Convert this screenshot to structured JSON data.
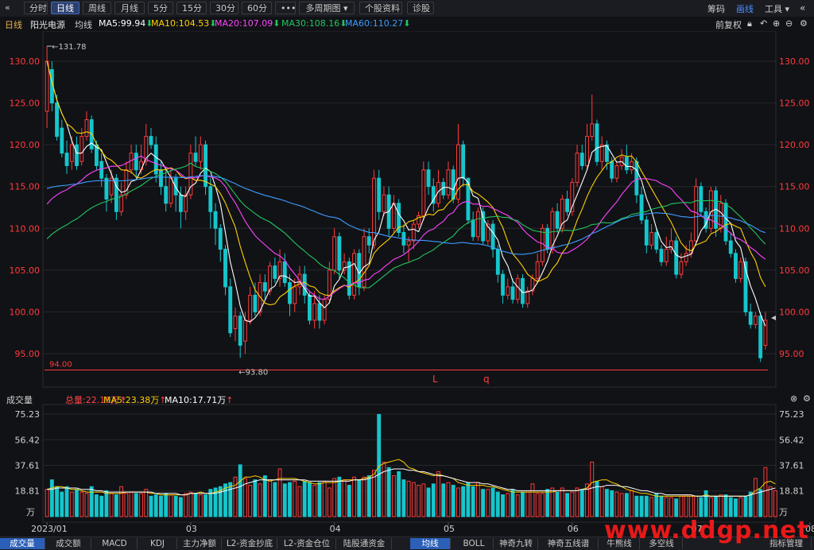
{
  "toolbar": {
    "back": "«",
    "buttons": [
      "分时",
      "日线",
      "周线",
      "月线",
      "5分",
      "15分",
      "30分",
      "60分",
      "•••",
      "多周期图",
      "个股资料",
      "诊股"
    ],
    "active_index": 1,
    "right": [
      "筹码",
      "画线",
      "工具"
    ],
    "right_active_index": 1
  },
  "info": {
    "period": "日线",
    "name": "阳光电源",
    "avg_label": "均线",
    "ma": [
      {
        "label": "MA5:99.94",
        "color": "#ffffff"
      },
      {
        "label": "MA10:104.53",
        "color": "#ffd000"
      },
      {
        "label": "MA20:107.09",
        "color": "#ff44ff"
      },
      {
        "label": "MA30:108.16",
        "color": "#22c55e"
      },
      {
        "label": "MA60:110.27",
        "color": "#3b9cff"
      }
    ],
    "adjust": "前复权"
  },
  "volume_info": {
    "title": "成交量",
    "total": "总量:22.15万",
    "ma5": "MA5:23.38万",
    "ma10": "MA10:17.71万"
  },
  "bottom_tabs": [
    "成交量",
    "成交额",
    "MACD",
    "KDJ",
    "主力净额",
    "L2-资金抄底",
    "L2-资金仓位",
    "陆股通资金",
    "均线",
    "BOLL",
    "神奇九转",
    "神奇五线谱",
    "牛熊线",
    "多空线",
    "指标管理"
  ],
  "watermark": "www.ddgp.net",
  "colors": {
    "up": "#ff3b3b",
    "down": "#15c6cc",
    "ma5": "#ffffff",
    "ma10": "#ffd000",
    "ma20": "#ff44ff",
    "ma30": "#22c55e",
    "ma60": "#3b9cff"
  },
  "chart_data": [
    {
      "type": "candlestick",
      "yticks": [
        "130.00",
        "125.00",
        "120.00",
        "115.00",
        "110.00",
        "105.00",
        "100.00",
        "95.00"
      ],
      "ylim": [
        92.5,
        132.5
      ],
      "xticks": [
        "2023/01",
        "03",
        "04",
        "05",
        "06",
        "07",
        "08"
      ],
      "annotations": {
        "high": "131.78",
        "low": "93.80",
        "level": "94.00",
        "markers": [
          "L",
          "q"
        ]
      },
      "candles": [
        [
          124,
          130,
          122,
          131.8
        ],
        [
          129,
          125,
          124,
          130
        ],
        [
          125,
          121,
          120.5,
          126
        ],
        [
          122,
          119,
          118.5,
          123
        ],
        [
          119,
          117.5,
          116.5,
          120.5
        ],
        [
          118,
          120,
          117,
          121
        ],
        [
          120,
          117.5,
          117,
          121
        ],
        [
          118,
          121,
          117.5,
          122
        ],
        [
          121,
          123,
          120.5,
          124
        ],
        [
          123,
          119.5,
          119,
          123.5
        ],
        [
          120,
          117.5,
          117,
          120.5
        ],
        [
          118,
          116,
          115,
          119
        ],
        [
          116,
          113.5,
          112,
          116.5
        ],
        [
          114,
          116,
          113,
          117
        ],
        [
          116,
          112,
          111,
          116.5
        ],
        [
          112,
          114,
          111.5,
          115.5
        ],
        [
          114,
          117,
          113.5,
          118
        ],
        [
          117,
          119,
          116.5,
          120
        ],
        [
          119,
          117,
          116,
          120
        ],
        [
          117,
          118,
          116.5,
          120
        ],
        [
          118,
          121,
          117.5,
          122.5
        ],
        [
          121,
          120,
          119.5,
          122
        ],
        [
          120,
          116.5,
          115.5,
          121
        ],
        [
          117,
          115,
          114,
          118
        ],
        [
          115,
          113,
          112,
          117
        ],
        [
          113,
          116,
          112.5,
          117
        ],
        [
          116,
          114,
          112,
          116.5
        ],
        [
          114,
          112,
          110,
          115
        ],
        [
          112,
          114,
          111,
          115
        ],
        [
          114,
          119,
          113.5,
          120
        ],
        [
          119,
          118,
          117.5,
          121
        ],
        [
          118,
          120,
          117,
          121
        ],
        [
          120,
          115,
          114,
          120.5
        ],
        [
          115,
          112,
          110,
          116
        ],
        [
          112,
          110,
          108,
          113
        ],
        [
          110,
          107.5,
          106,
          110.5
        ],
        [
          107.5,
          103,
          102,
          108
        ],
        [
          103,
          97.5,
          97,
          104
        ],
        [
          98,
          99.5,
          96.5,
          100.5
        ],
        [
          99.5,
          96,
          94.5,
          100
        ],
        [
          96.5,
          99,
          95,
          100
        ],
        [
          99,
          102,
          98.5,
          103
        ],
        [
          102,
          100,
          99.5,
          103.5
        ],
        [
          100,
          103.5,
          99.5,
          104.5
        ],
        [
          103.5,
          102.5,
          101.5,
          104.5
        ],
        [
          102.5,
          105.5,
          102,
          106
        ],
        [
          105.5,
          104,
          103.5,
          106.5
        ],
        [
          104,
          106,
          103,
          107.5
        ],
        [
          106,
          103.5,
          103,
          107
        ],
        [
          103.5,
          101,
          99.5,
          104.5
        ],
        [
          101,
          103,
          100,
          104
        ],
        [
          103,
          104.5,
          102,
          105.5
        ],
        [
          104.5,
          102,
          101,
          105.5
        ],
        [
          102,
          99,
          98.5,
          102.5
        ],
        [
          99,
          101,
          98,
          102.5
        ],
        [
          101,
          99,
          98,
          102
        ],
        [
          99,
          101.5,
          98.5,
          102
        ],
        [
          101.5,
          105,
          101,
          106
        ],
        [
          105,
          109,
          104.5,
          110
        ],
        [
          109,
          105,
          104,
          109.5
        ],
        [
          105,
          106,
          104.5,
          107
        ],
        [
          106,
          102,
          101.5,
          106.5
        ],
        [
          102,
          107,
          101.5,
          107.5
        ],
        [
          107,
          103,
          102,
          107.5
        ],
        [
          103,
          109,
          102.5,
          110
        ],
        [
          109,
          108,
          107,
          110
        ],
        [
          108,
          116,
          107.5,
          117
        ],
        [
          116,
          112,
          111,
          117
        ],
        [
          112,
          114,
          111.5,
          115
        ],
        [
          114,
          110,
          109,
          115
        ],
        [
          110,
          113,
          109.5,
          114
        ],
        [
          113,
          109.5,
          109,
          113.5
        ],
        [
          109.5,
          108,
          107,
          110.5
        ],
        [
          108,
          108.5,
          106,
          109
        ],
        [
          108.5,
          110.5,
          107.5,
          111
        ],
        [
          110.5,
          111.5,
          110,
          112
        ],
        [
          111.5,
          117,
          111,
          118
        ],
        [
          117,
          115,
          114,
          118
        ],
        [
          115,
          113,
          112,
          116
        ],
        [
          113,
          115.5,
          112.5,
          117
        ],
        [
          115.5,
          114,
          113.5,
          116
        ],
        [
          114,
          117,
          113.5,
          118
        ],
        [
          117,
          113.5,
          113,
          117.5
        ],
        [
          113.5,
          120,
          113,
          122.5
        ],
        [
          120,
          116,
          115,
          120.5
        ],
        [
          116,
          111,
          110.5,
          116
        ],
        [
          111,
          109,
          108.5,
          112
        ],
        [
          109,
          112,
          108.5,
          112.5
        ],
        [
          112,
          108.5,
          108,
          112.5
        ],
        [
          108.5,
          110.5,
          108,
          111
        ],
        [
          110.5,
          107.5,
          106.5,
          111
        ],
        [
          107.5,
          104.5,
          103.5,
          108
        ],
        [
          104.5,
          102,
          101,
          105
        ],
        [
          102,
          103,
          101.5,
          104
        ],
        [
          103,
          101.5,
          101,
          104
        ],
        [
          101.5,
          104,
          101,
          104.5
        ],
        [
          104,
          101,
          100.5,
          104.5
        ],
        [
          101,
          102.5,
          100.5,
          103
        ],
        [
          102.5,
          104,
          102,
          104.5
        ],
        [
          104,
          106,
          103.5,
          107
        ],
        [
          106,
          110,
          105.5,
          110.5
        ],
        [
          110,
          107.5,
          107,
          110.5
        ],
        [
          107.5,
          112,
          107,
          112.5
        ],
        [
          112,
          110,
          109.5,
          113
        ],
        [
          110,
          113.5,
          109.5,
          114
        ],
        [
          113.5,
          112,
          111.5,
          114.5
        ],
        [
          112,
          115.5,
          111.5,
          116
        ],
        [
          115.5,
          119,
          115,
          120
        ],
        [
          119,
          117.5,
          117,
          120
        ],
        [
          117.5,
          121,
          117,
          122.5
        ],
        [
          121,
          122.5,
          120.5,
          126
        ],
        [
          122.5,
          118,
          117.5,
          123
        ],
        [
          118,
          120,
          117,
          121
        ],
        [
          120,
          118,
          117,
          120.5
        ],
        [
          118,
          116,
          115.5,
          118.5
        ],
        [
          116,
          117.5,
          115.5,
          118
        ],
        [
          117.5,
          118.5,
          117,
          119.5
        ],
        [
          118.5,
          117,
          116.5,
          120
        ],
        [
          117,
          118,
          116.5,
          119
        ],
        [
          118,
          114,
          113,
          118.5
        ],
        [
          114,
          111,
          110.5,
          115
        ],
        [
          111,
          108,
          107,
          111.5
        ],
        [
          108,
          109.5,
          107.5,
          110.5
        ],
        [
          109.5,
          107.5,
          107,
          110
        ],
        [
          107.5,
          106,
          105.5,
          108
        ],
        [
          106,
          107.5,
          105.5,
          109
        ],
        [
          107.5,
          108.5,
          107,
          110
        ],
        [
          108.5,
          104.5,
          104,
          109
        ],
        [
          104.5,
          106,
          104,
          107
        ],
        [
          106,
          107,
          105.5,
          108
        ],
        [
          107,
          108.5,
          106.5,
          109.5
        ],
        [
          108.5,
          115,
          108,
          116
        ],
        [
          115,
          112,
          111.5,
          115.5
        ],
        [
          112,
          110,
          109.5,
          112.5
        ],
        [
          110,
          114.5,
          109.5,
          115
        ],
        [
          114.5,
          110,
          109,
          115
        ],
        [
          110,
          113,
          109.5,
          114
        ],
        [
          113,
          108.5,
          108,
          113.5
        ],
        [
          108.5,
          107,
          106.5,
          109.5
        ],
        [
          107,
          104,
          103.5,
          107.5
        ],
        [
          104,
          106,
          103.5,
          106.5
        ],
        [
          106,
          100,
          99.5,
          106.5
        ],
        [
          100,
          98.5,
          98,
          101
        ],
        [
          98.5,
          99.5,
          98,
          100
        ],
        [
          99.5,
          94.5,
          94,
          100
        ],
        [
          96,
          99,
          95.5,
          100
        ]
      ]
    },
    {
      "type": "bar",
      "title": "成交量",
      "yticks": [
        "75.23",
        "56.42",
        "37.61",
        "18.81",
        "万"
      ],
      "ylim": [
        0,
        75.23
      ],
      "values": [
        20,
        27,
        22,
        18,
        22,
        18,
        20,
        18,
        17,
        22,
        16,
        15,
        19,
        17,
        16,
        22,
        17,
        18,
        17,
        17,
        20,
        15,
        16,
        15,
        17,
        16,
        15,
        14,
        17,
        18,
        17,
        16,
        16,
        20,
        21,
        22,
        24,
        25,
        29,
        38,
        28,
        23,
        27,
        24,
        30,
        27,
        25,
        35,
        24,
        25,
        26,
        22,
        26,
        25,
        23,
        25,
        26,
        21,
        28,
        29,
        27,
        23,
        29,
        27,
        29,
        30,
        34,
        75,
        40,
        36,
        30,
        33,
        27,
        26,
        25,
        23,
        24,
        21,
        24,
        33,
        24,
        25,
        23,
        21,
        22,
        25,
        22,
        25,
        20,
        20,
        21,
        18,
        16,
        17,
        20,
        16,
        18,
        18,
        24,
        17,
        17,
        20,
        21,
        18,
        21,
        17,
        18,
        21,
        20,
        24,
        40,
        26,
        22,
        20,
        19,
        18,
        17,
        17,
        19,
        15,
        15,
        15,
        14,
        17,
        15,
        14,
        14,
        13,
        15,
        16,
        15,
        15,
        14,
        19,
        14,
        15,
        16,
        16,
        14,
        13,
        14,
        15,
        18,
        28,
        20,
        36,
        22,
        19
      ],
      "ma5": [
        20,
        21,
        22,
        22,
        21,
        20,
        20,
        19,
        18,
        18,
        18,
        18,
        17,
        17,
        17,
        17,
        18,
        18,
        18,
        18,
        18,
        17,
        17,
        16,
        16,
        16,
        16,
        16,
        16,
        17,
        17,
        18,
        17,
        17,
        18,
        19,
        21,
        22,
        23,
        26,
        29,
        29,
        30,
        29,
        27,
        26,
        27,
        28,
        28,
        28,
        28,
        27,
        26,
        25,
        24,
        24,
        25,
        25,
        25,
        26,
        27,
        27,
        27,
        27,
        28,
        29,
        31,
        37,
        39,
        40,
        41,
        42,
        40,
        36,
        35,
        33,
        32,
        31,
        30,
        31,
        30,
        29,
        28,
        25,
        24,
        23,
        23,
        23,
        23,
        22,
        22,
        21,
        20,
        19,
        18,
        18,
        18,
        18,
        18,
        18,
        18,
        18,
        18,
        19,
        19,
        19,
        19,
        19,
        20,
        21,
        25,
        26,
        27,
        27,
        25,
        24,
        22,
        20,
        19,
        18,
        17,
        17,
        16,
        15,
        15,
        15,
        15,
        15,
        15,
        15,
        15,
        15,
        15,
        16,
        15,
        15,
        15,
        15,
        15,
        15,
        15,
        15,
        16,
        19,
        21,
        25,
        26,
        24
      ],
      "ma10": [
        20,
        20,
        21,
        21,
        21,
        21,
        21,
        20,
        20,
        20,
        19,
        19,
        18,
        18,
        18,
        18,
        18,
        18,
        18,
        18,
        18,
        18,
        17,
        17,
        17,
        17,
        17,
        16,
        16,
        17,
        17,
        17,
        17,
        17,
        17,
        18,
        19,
        20,
        21,
        22,
        24,
        25,
        26,
        27,
        27,
        27,
        27,
        27,
        27,
        27,
        27,
        27,
        27,
        26,
        26,
        26,
        26,
        26,
        26,
        26,
        26,
        26,
        27,
        27,
        27,
        28,
        29,
        31,
        33,
        34,
        35,
        35,
        35,
        34,
        34,
        33,
        33,
        32,
        31,
        30,
        30,
        29,
        28,
        27,
        26,
        25,
        25,
        25,
        24,
        24,
        23,
        22,
        21,
        20,
        20,
        19,
        19,
        19,
        19,
        19,
        19,
        19,
        19,
        19,
        19,
        19,
        19,
        19,
        20,
        20,
        21,
        22,
        22,
        23,
        23,
        23,
        22,
        22,
        21,
        20,
        19,
        19,
        18,
        17,
        17,
        16,
        16,
        16,
        16,
        16,
        16,
        15,
        15,
        15,
        15,
        15,
        15,
        15,
        15,
        15,
        15,
        15,
        16,
        17,
        18,
        19,
        20,
        21
      ]
    }
  ]
}
